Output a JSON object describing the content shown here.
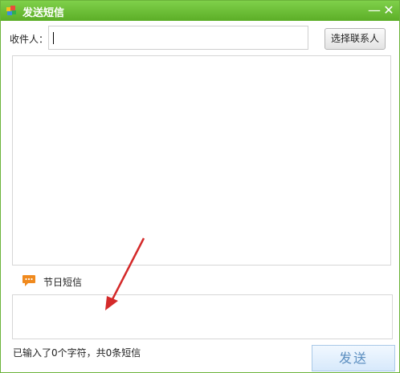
{
  "window": {
    "title": "发送短信",
    "minimize_glyph": "—",
    "close_glyph": "✕"
  },
  "recipient": {
    "label": "收件人：",
    "value": ""
  },
  "select_contact_label": "选择联系人",
  "holiday": {
    "label": "节日短信",
    "icon": "chat-bubble-icon"
  },
  "compose": {
    "value": ""
  },
  "status": {
    "counter_text": "已输入了0个字符，共0条短信"
  },
  "send_label": "发送",
  "colors": {
    "titlebar": "#5cae27",
    "annotation_arrow": "#d42a2a",
    "holiday_icon": "#f08a1e"
  }
}
